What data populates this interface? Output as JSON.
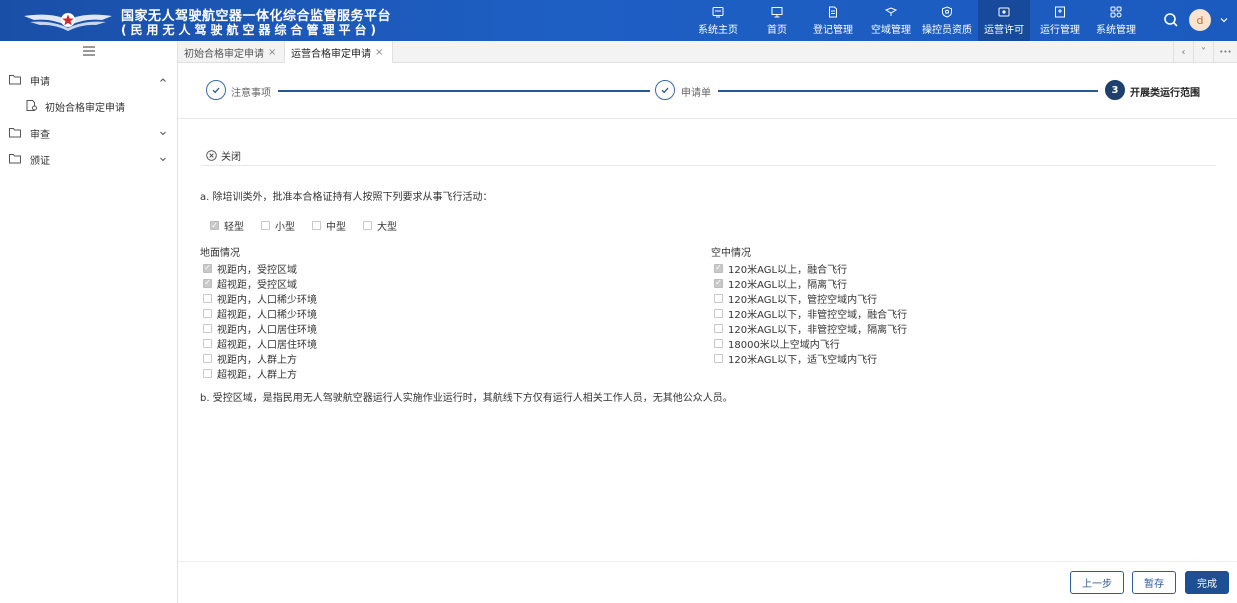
{
  "header": {
    "title_line1": "国家无人驾驶航空器一体化综合监管服务平台",
    "title_line2": "(民用无人驾驶航空器综合管理平台)",
    "nav": [
      {
        "label": "系统主页",
        "icon": "home-screen-icon"
      },
      {
        "label": "首页",
        "icon": "monitor-icon"
      },
      {
        "label": "登记管理",
        "icon": "document-icon"
      },
      {
        "label": "空域管理",
        "icon": "airspace-icon"
      },
      {
        "label": "操控员资质",
        "icon": "shield-icon"
      },
      {
        "label": "运营许可",
        "icon": "license-icon"
      },
      {
        "label": "运行管理",
        "icon": "calendar-icon"
      },
      {
        "label": "系统管理",
        "icon": "settings-icon"
      }
    ],
    "avatar_letter": "d"
  },
  "sidebar": {
    "items": [
      {
        "label": "申请"
      },
      {
        "label": "初始合格审定申请"
      },
      {
        "label": "审查"
      },
      {
        "label": "颁证"
      }
    ]
  },
  "tabs": [
    {
      "label": "初始合格审定申请",
      "close": "×"
    },
    {
      "label": "运营合格审定申请",
      "close": "×"
    }
  ],
  "tab_controls": {
    "prev": "‹",
    "more": "˅",
    "dots": "•••"
  },
  "steps": [
    {
      "label": "注意事项",
      "state": "done"
    },
    {
      "label": "申请单",
      "state": "done"
    },
    {
      "label": "开展类运行范围",
      "number": "3",
      "state": "current"
    }
  ],
  "content": {
    "close_label": "关闭",
    "intro_a": "a. 除培训类外，批准本合格证持有人按照下列要求从事飞行活动：",
    "types": [
      {
        "label": "轻型",
        "checked": true
      },
      {
        "label": "小型",
        "checked": false
      },
      {
        "label": "中型",
        "checked": false
      },
      {
        "label": "大型",
        "checked": false
      }
    ],
    "ground_title": "地面情况",
    "ground_options": [
      {
        "label": "视距内，受控区域",
        "checked": true
      },
      {
        "label": "超视距，受控区域",
        "checked": true
      },
      {
        "label": "视距内，人口稀少环境",
        "checked": false
      },
      {
        "label": "超视距，人口稀少环境",
        "checked": false
      },
      {
        "label": "视距内，人口居住环境",
        "checked": false
      },
      {
        "label": "超视距，人口居住环境",
        "checked": false
      },
      {
        "label": "视距内，人群上方",
        "checked": false
      },
      {
        "label": "超视距，人群上方",
        "checked": false
      }
    ],
    "air_title": "空中情况",
    "air_options": [
      {
        "label": "120米AGL以上，融合飞行",
        "checked": true
      },
      {
        "label": "120米AGL以上，隔离飞行",
        "checked": true
      },
      {
        "label": "120米AGL以下，管控空域内飞行",
        "checked": false
      },
      {
        "label": "120米AGL以下，非管控空域，融合飞行",
        "checked": false
      },
      {
        "label": "120米AGL以下，非管控空域，隔离飞行",
        "checked": false
      },
      {
        "label": "18000米以上空域内飞行",
        "checked": false
      },
      {
        "label": "120米AGL以下，适飞空域内飞行",
        "checked": false
      }
    ],
    "note_b": "b. 受控区域，是指民用无人驾驶航空器运行人实施作业运行时，其航线下方仅有运行人相关工作人员，无其他公众人员。"
  },
  "footer": {
    "prev_label": "上一步",
    "save_label": "暂存",
    "finish_label": "完成"
  }
}
